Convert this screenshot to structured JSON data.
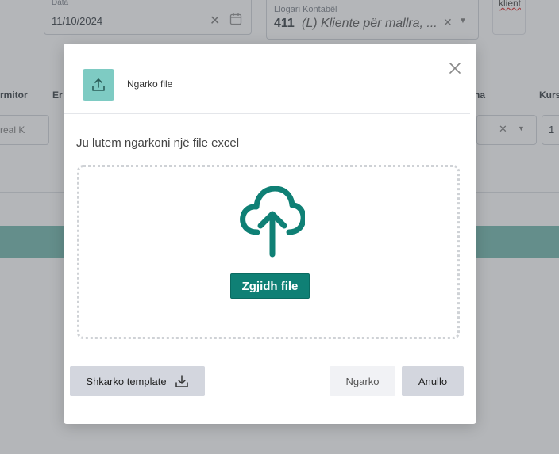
{
  "background": {
    "date_label": "Data",
    "date_value": "11/10/2024",
    "account_label": "Llogari Kontabël",
    "account_code": "411",
    "account_value": "(L)  Kliente për mallra, ...",
    "client_link": "klient",
    "col_partial_left": "rmitor",
    "col_partial_e": "Er",
    "col_partial_right": "na",
    "col_partial_kurs": "Kurs",
    "cell_partial_left": "real K",
    "cell_partial_right": "1"
  },
  "modal": {
    "title": "Ngarko file",
    "instruction": "Ju lutem ngarkoni një file excel",
    "choose_file": "Zgjidh file",
    "download_template": "Shkarko template",
    "upload": "Ngarko",
    "cancel": "Anullo"
  },
  "colors": {
    "accent": "#0f8075",
    "icon_bg": "#7ecbc3"
  }
}
